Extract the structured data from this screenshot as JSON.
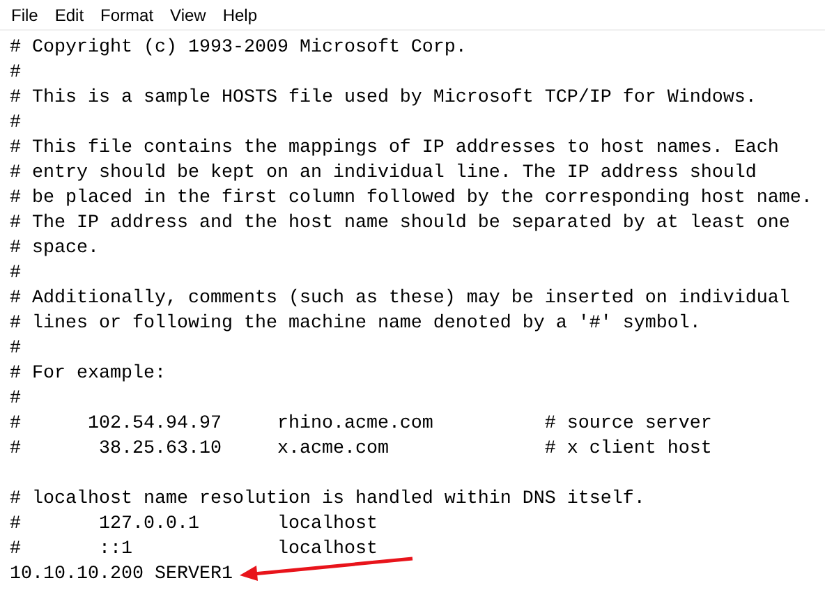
{
  "menu": [
    "File",
    "Edit",
    "Format",
    "View",
    "Help"
  ],
  "blocks": [
    [
      "# Copyright (c) 1993-2009 Microsoft Corp.",
      "#",
      "# This is a sample HOSTS file used by Microsoft TCP/IP for Windows.",
      "#",
      "# This file contains the mappings of IP addresses to host names. Each",
      "# entry should be kept on an individual line. The IP address should",
      "# be placed in the first column followed by the corresponding host name.",
      "# The IP address and the host name should be separated by at least one",
      "# space.",
      "#",
      "# Additionally, comments (such as these) may be inserted on individual",
      "# lines or following the machine name denoted by a '#' symbol.",
      "#",
      "# For example:",
      "#",
      "#      102.54.94.97     rhino.acme.com          # source server",
      "#       38.25.63.10     x.acme.com              # x client host"
    ],
    [
      "# localhost name resolution is handled within DNS itself.",
      "#       127.0.0.1       localhost",
      "#       ::1             localhost",
      "10.10.10.200 SERVER1"
    ]
  ]
}
